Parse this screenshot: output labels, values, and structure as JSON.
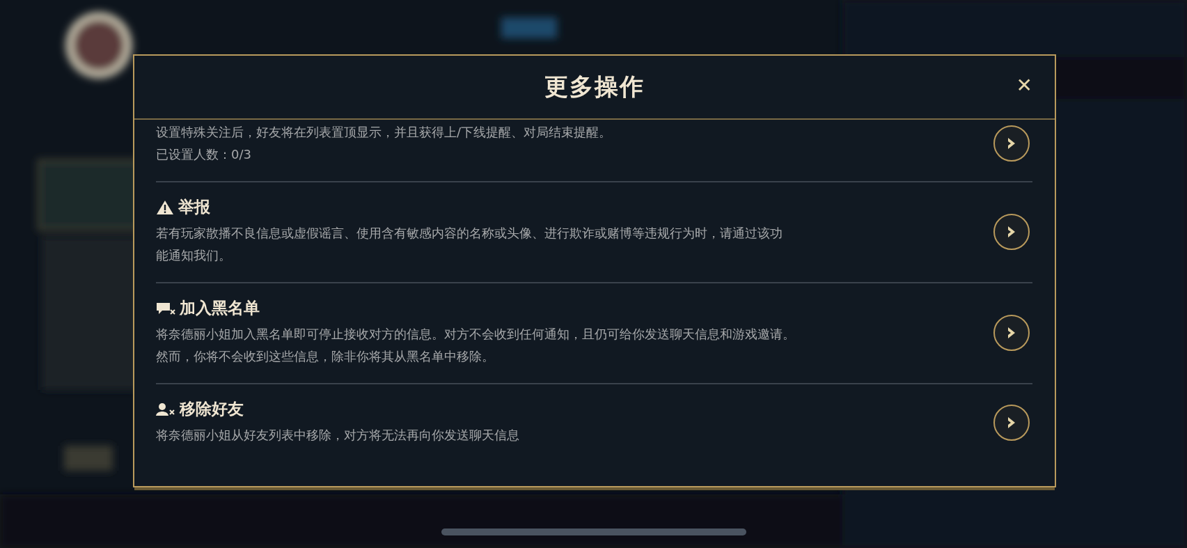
{
  "dialog": {
    "title": "更多操作",
    "close": "✕",
    "items": [
      {
        "lines": [
          "设置特殊关注后，好友将在列表置顶显示，并且获得上/下线提醒、对局结束提醒。",
          "已设置人数：0/3"
        ]
      },
      {
        "title": "举报",
        "lines": [
          "若有玩家散播不良信息或虚假谣言、使用含有敏感内容的名称或头像、进行欺诈或赌博等违规行为时，请通过该功",
          "能通知我们。"
        ]
      },
      {
        "title": "加入黑名单",
        "lines": [
          "将奈德丽小姐加入黑名单即可停止接收对方的信息。对方不会收到任何通知，且仍可给你发送聊天信息和游戏邀请。",
          "然而，你将不会收到这些信息，除非你将其从黑名单中移除。"
        ]
      },
      {
        "title": "移除好友",
        "lines": [
          "将奈德丽小姐从好友列表中移除，对方将无法再向你发送聊天信息"
        ]
      }
    ]
  }
}
